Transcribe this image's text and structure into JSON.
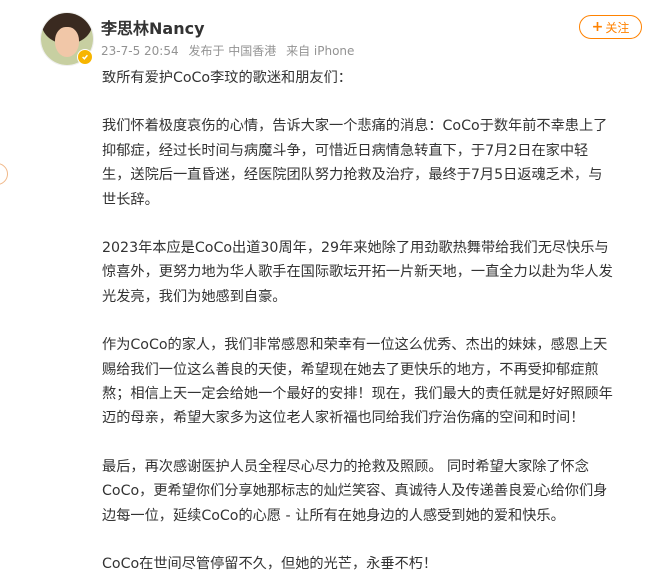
{
  "user": {
    "name": "李思林Nancy",
    "date": "23-7-5 20:54",
    "location": "发布于 中国香港",
    "source": "来自 iPhone"
  },
  "follow_button": {
    "label": "关注",
    "plus": "+"
  },
  "post": {
    "paragraphs": [
      "致所有爱护CoCo李玟的歌迷和朋友们：",
      "我们怀着极度哀伤的心情，告诉大家一个悲痛的消息：CoCo于数年前不幸患上了\n抑郁症，经过长时间与病魔斗争，可惜近日病情急转直下，于7月2日在家中轻\n生，送院后一直昏迷，经医院团队努力抢救及治疗，最终于7月5日返魂乏术，与\n世长辞。",
      "2023年本应是CoCo出道30周年，29年来她除了用劲歌热舞带给我们无尽快乐与\n惊喜外，更努力地为华人歌手在国际歌坛开拓一片新天地，一直全力以赴为华人发\n光发亮，我们为她感到自豪。",
      "作为CoCo的家人，我们非常感恩和荣幸有一位这么优秀、杰出的妹妹，感恩上天\n赐给我们一位这么善良的天使，希望现在她去了更快乐的地方，不再受抑郁症煎\n熬；相信上天一定会给她一个最好的安排！现在，我们最大的责任就是好好照顾年\n迈的母亲，希望大家多为这位老人家祈福也同给我们疗治伤痛的空间和时间！",
      "最后，再次感谢医护人员全程尽心尽力的抢救及照顾。 同时希望大家除了怀念\nCoCo，更希望你们分享她那标志的灿烂笑容、真诚待人及传递善良爱心给你们身\n边每一位，延续CoCo的心愿 - 让所有在她身边的人感受到她的爱和快乐。",
      "CoCo在世间尽管停留不久，但她的光芒，永垂不朽！"
    ]
  },
  "colors": {
    "accent": "#ff8200",
    "meta": "#939393",
    "badge": "#f7b500"
  }
}
